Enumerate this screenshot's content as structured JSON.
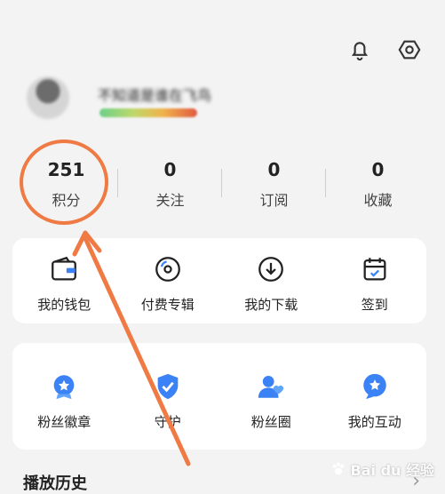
{
  "header": {
    "notification_icon": "bell-icon",
    "settings_icon": "settings-hexagon-icon"
  },
  "profile": {
    "nickname": "不知道是谁在飞鸟",
    "level_bar_colors": [
      "#6bd089",
      "#bfd86a",
      "#f0b24a",
      "#e05a42"
    ]
  },
  "stats": [
    {
      "value": "251",
      "label": "积分"
    },
    {
      "value": "0",
      "label": "关注"
    },
    {
      "value": "0",
      "label": "订阅"
    },
    {
      "value": "0",
      "label": "收藏"
    }
  ],
  "quick_actions": [
    {
      "label": "我的钱包",
      "icon": "wallet-icon"
    },
    {
      "label": "付费专辑",
      "icon": "disc-icon"
    },
    {
      "label": "我的下载",
      "icon": "download-icon"
    },
    {
      "label": "签到",
      "icon": "calendar-check-icon"
    }
  ],
  "fan_actions": [
    {
      "label": "粉丝徽章",
      "icon": "badge-icon"
    },
    {
      "label": "守护",
      "icon": "shield-check-icon"
    },
    {
      "label": "粉丝圈",
      "icon": "fans-icon"
    },
    {
      "label": "我的互动",
      "icon": "chat-star-icon"
    }
  ],
  "history": {
    "title": "播放历史",
    "chevron": "›"
  },
  "watermark": {
    "text": "Bai du 经验"
  },
  "colors": {
    "accent": "#3b82f6",
    "highlight": "#f07a44"
  }
}
